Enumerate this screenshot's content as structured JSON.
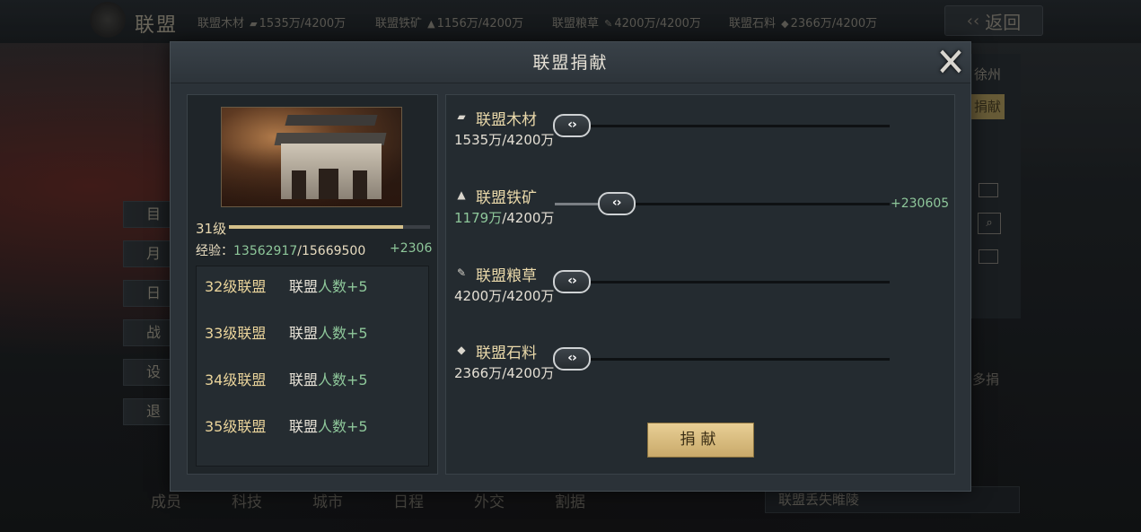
{
  "background": {
    "title": "联盟",
    "resources": [
      {
        "name": "联盟木材",
        "icon": "wood-icon",
        "value": "1535万/4200万"
      },
      {
        "name": "联盟铁矿",
        "icon": "iron-icon",
        "value": "1156万/4200万"
      },
      {
        "name": "联盟粮草",
        "icon": "grain-icon",
        "value": "4200万/4200万"
      },
      {
        "name": "联盟石料",
        "icon": "stone-icon",
        "value": "2366万/4200万"
      }
    ],
    "back_label": "返回",
    "left_menu": [
      "目标",
      "月旦",
      "日志",
      "战报",
      "设置",
      "退出"
    ],
    "bottom_tabs": [
      "成员",
      "科技",
      "城市",
      "日程",
      "外交",
      "割据"
    ],
    "right_city": "徐州",
    "right_donate": "捐献",
    "right_misc": "多捐",
    "bottom_notice": "联盟丢失睢陵"
  },
  "modal": {
    "title": "联盟捐献",
    "close_icon": "close-icon",
    "level": {
      "label": "31级",
      "exp_label": "经验：",
      "exp_current": "13562917",
      "exp_total": "/15669500",
      "exp_plus": "+2306",
      "progress": 0.865
    },
    "unlocks": [
      {
        "level": "32级联盟",
        "desc": "联盟",
        "value": "人数+5"
      },
      {
        "level": "33级联盟",
        "desc": "联盟",
        "value": "人数+5"
      },
      {
        "level": "34级联盟",
        "desc": "联盟",
        "value": "人数+5"
      },
      {
        "level": "35级联盟",
        "desc": "联盟",
        "value": "人数+5"
      }
    ],
    "resources": [
      {
        "name": "联盟木材",
        "icon": "wood-icon",
        "glyph": "▰",
        "amount_main": "1535万",
        "amount_rest": "/4200万",
        "green": false,
        "slider": 0.0,
        "plus": ""
      },
      {
        "name": "联盟铁矿",
        "icon": "iron-ore-icon",
        "glyph": "▲",
        "amount_main": "1179万",
        "amount_rest": "/4200万",
        "green": true,
        "slider": 0.15,
        "plus": "+230605"
      },
      {
        "name": "联盟粮草",
        "icon": "grain-icon",
        "glyph": "✎",
        "amount_main": "4200万",
        "amount_rest": "/4200万",
        "green": false,
        "slider": 0.0,
        "plus": ""
      },
      {
        "name": "联盟石料",
        "icon": "stone-icon",
        "glyph": "◆",
        "amount_main": "2366万",
        "amount_rest": "/4200万",
        "green": false,
        "slider": 0.0,
        "plus": ""
      }
    ],
    "knob_label": "‹›",
    "donate_label": "捐献"
  }
}
